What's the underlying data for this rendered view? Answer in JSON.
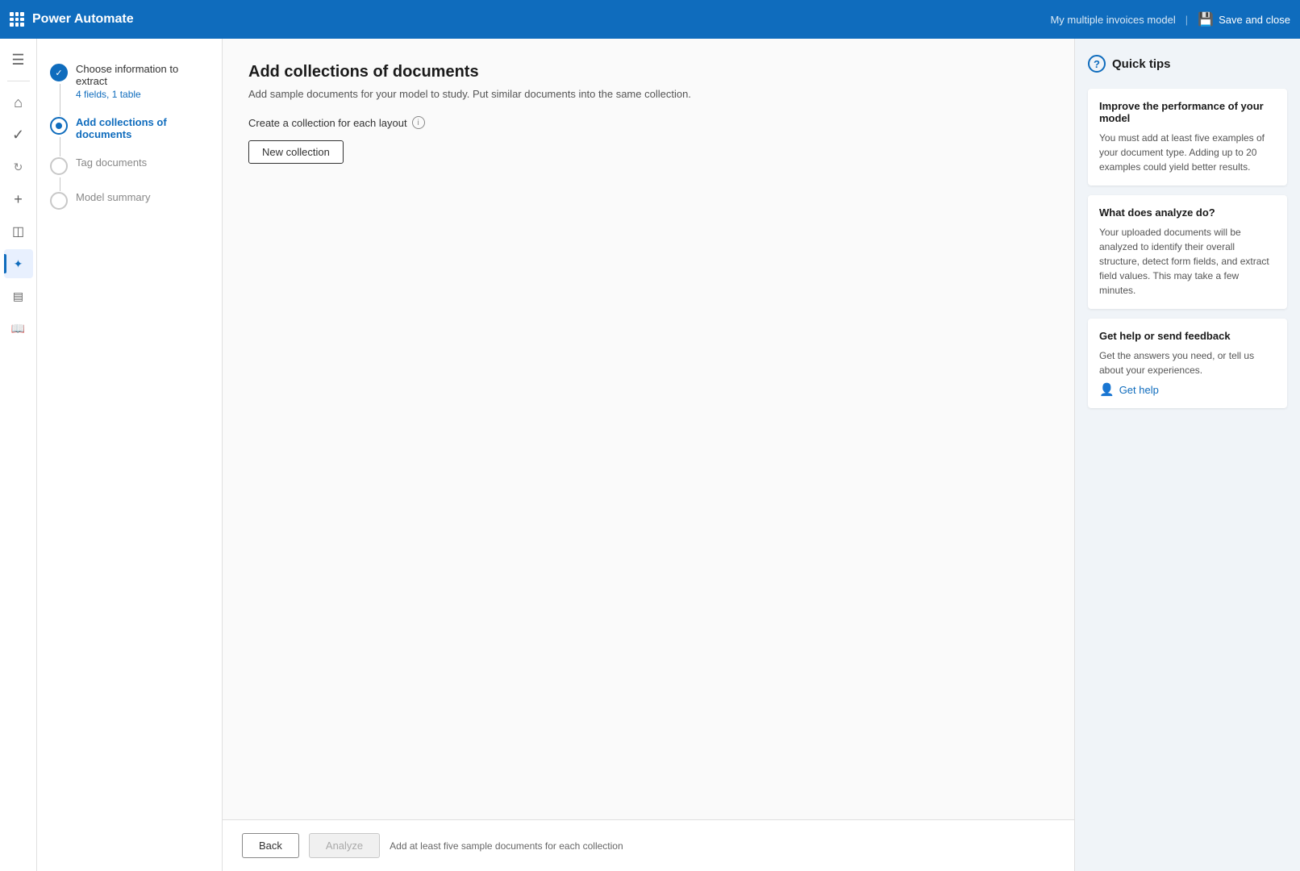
{
  "topbar": {
    "app_name": "Power Automate",
    "model_name": "My multiple invoices model",
    "separator": "|",
    "save_close_label": "Save and close"
  },
  "steps": [
    {
      "id": "step-1",
      "title": "Choose information to extract",
      "subtitle": "4 fields, 1 table",
      "state": "completed"
    },
    {
      "id": "step-2",
      "title": "Add collections of documents",
      "subtitle": "",
      "state": "active"
    },
    {
      "id": "step-3",
      "title": "Tag documents",
      "subtitle": "",
      "state": "inactive"
    },
    {
      "id": "step-4",
      "title": "Model summary",
      "subtitle": "",
      "state": "inactive"
    }
  ],
  "main": {
    "page_title": "Add collections of documents",
    "page_subtitle": "Add sample documents for your model to study. Put similar documents into the same collection.",
    "collection_label": "Create a collection for each layout",
    "new_collection_button": "New collection"
  },
  "bottom_bar": {
    "back_label": "Back",
    "analyze_label": "Analyze",
    "hint": "Add at least five sample documents for each collection"
  },
  "quick_tips": {
    "title": "Quick tips",
    "cards": [
      {
        "title": "Improve the performance of your model",
        "text": "You must add at least five examples of your document type. Adding up to 20 examples could yield better results."
      },
      {
        "title": "What does analyze do?",
        "text": "Your uploaded documents will be analyzed to identify their overall structure, detect form fields, and extract field values. This may take a few minutes."
      },
      {
        "title": "Get help or send feedback",
        "text": "Get the answers you need, or tell us about your experiences.",
        "link": "Get help"
      }
    ]
  },
  "nav_icons": [
    {
      "name": "home-icon",
      "symbol": "⌂"
    },
    {
      "name": "apps-icon",
      "symbol": "▦"
    },
    {
      "name": "flows-icon",
      "symbol": "↻"
    },
    {
      "name": "add-icon",
      "symbol": "+"
    },
    {
      "name": "monitor-icon",
      "symbol": "◫"
    },
    {
      "name": "ai-icon",
      "symbol": "✦"
    },
    {
      "name": "data-icon",
      "symbol": "🗄"
    },
    {
      "name": "book-icon",
      "symbol": "📖"
    }
  ]
}
